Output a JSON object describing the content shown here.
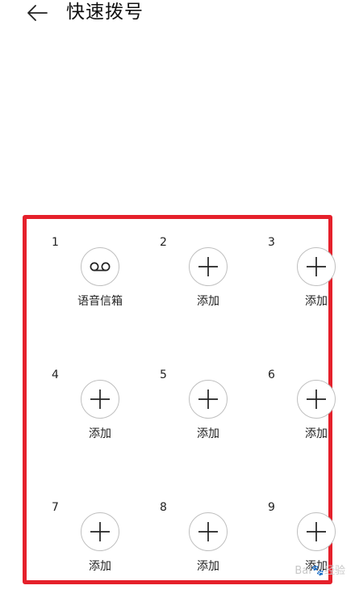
{
  "header": {
    "title": "快速拨号",
    "back_icon": "arrow-left-icon"
  },
  "grid": {
    "highlight_color": "#e5202b",
    "cells": [
      {
        "number": "1",
        "label": "语音信箱",
        "icon": "voicemail-icon"
      },
      {
        "number": "2",
        "label": "添加",
        "icon": "plus-icon"
      },
      {
        "number": "3",
        "label": "添加",
        "icon": "plus-icon"
      },
      {
        "number": "4",
        "label": "添加",
        "icon": "plus-icon"
      },
      {
        "number": "5",
        "label": "添加",
        "icon": "plus-icon"
      },
      {
        "number": "6",
        "label": "添加",
        "icon": "plus-icon"
      },
      {
        "number": "7",
        "label": "添加",
        "icon": "plus-icon"
      },
      {
        "number": "8",
        "label": "添加",
        "icon": "plus-icon"
      },
      {
        "number": "9",
        "label": "添加",
        "icon": "plus-icon"
      }
    ]
  },
  "watermark": "Bai🐾经验"
}
